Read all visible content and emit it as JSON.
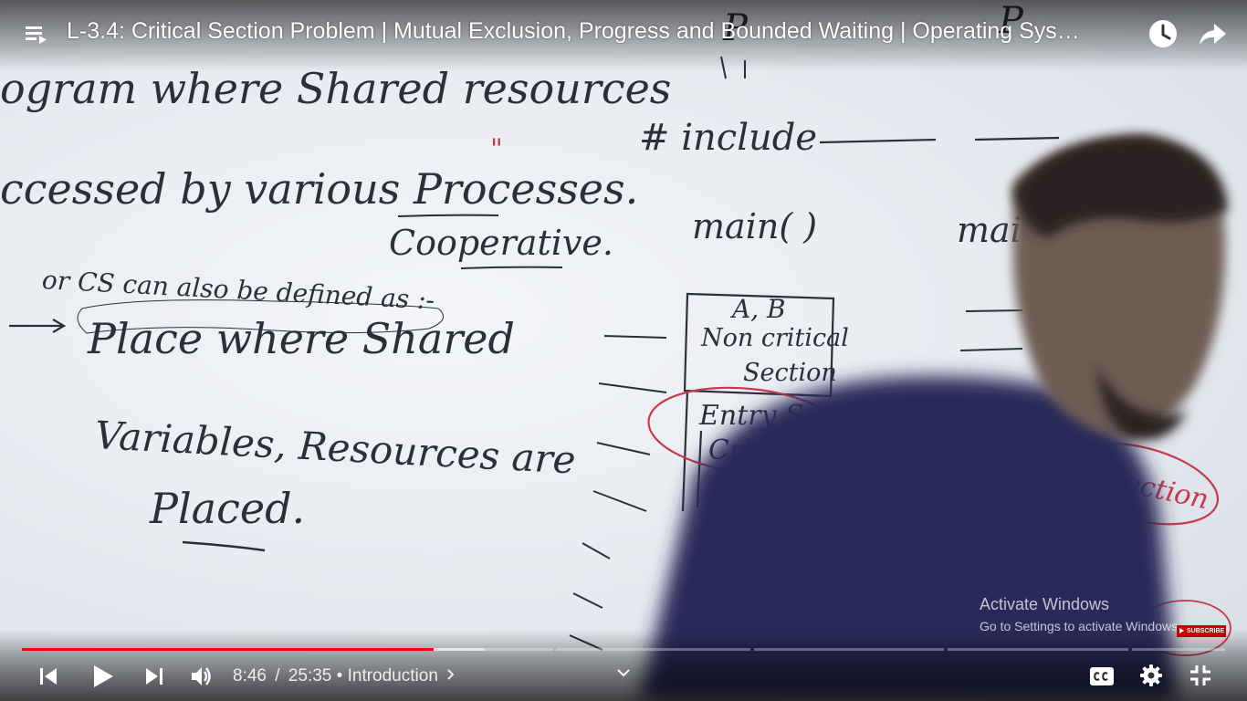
{
  "player": {
    "title": "L-3.4: Critical Section Problem | Mutual Exclusion, Progress and Bounded Waiting | Operating Sys…",
    "time_current": "8:46",
    "time_separator": "/",
    "time_total": "25:35",
    "chapter_bullet": "•",
    "chapter": "Introduction",
    "progress_played_fraction": 0.342,
    "progress_buffered_fraction": 0.385,
    "accent_color": "#ff0000",
    "icons": {
      "playlist": "playlist-icon",
      "watch_later": "clock-icon",
      "share": "share-icon",
      "previous": "skip-previous-icon",
      "play": "play-icon",
      "next": "skip-next-icon",
      "volume": "volume-icon",
      "expand": "chevron-down-icon",
      "captions": "captions-icon",
      "settings": "gear-icon",
      "exit_fullscreen": "exit-fullscreen-icon"
    }
  },
  "board": {
    "left_lines": [
      "ogram where Shared resources",
      "ccessed by various Processes.",
      "Cooperative.",
      "or CS can also be defined as :-",
      "Place where Shared",
      "Variables, Resources are",
      "Placed."
    ],
    "right_lines": [
      "# include",
      "main( )",
      "mai",
      "A, B",
      "Non critical",
      "Section",
      "Entry S",
      "Cri",
      "try Section",
      "P",
      "P"
    ],
    "quote_mark": "\""
  },
  "watermark": {
    "title": "Activate Windows",
    "subtitle": "Go to Settings to activate Windows.",
    "subscribe": "SUBSCRIBE"
  }
}
